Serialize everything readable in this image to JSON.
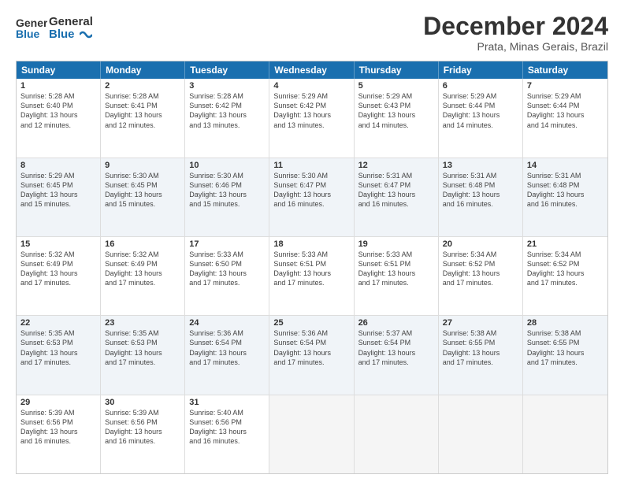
{
  "logo": {
    "general": "General",
    "blue": "Blue"
  },
  "header": {
    "title": "December 2024",
    "location": "Prata, Minas Gerais, Brazil"
  },
  "weekdays": [
    "Sunday",
    "Monday",
    "Tuesday",
    "Wednesday",
    "Thursday",
    "Friday",
    "Saturday"
  ],
  "rows": [
    [
      {
        "day": "1",
        "lines": [
          "Sunrise: 5:28 AM",
          "Sunset: 6:40 PM",
          "Daylight: 13 hours",
          "and 12 minutes."
        ]
      },
      {
        "day": "2",
        "lines": [
          "Sunrise: 5:28 AM",
          "Sunset: 6:41 PM",
          "Daylight: 13 hours",
          "and 12 minutes."
        ]
      },
      {
        "day": "3",
        "lines": [
          "Sunrise: 5:28 AM",
          "Sunset: 6:42 PM",
          "Daylight: 13 hours",
          "and 13 minutes."
        ]
      },
      {
        "day": "4",
        "lines": [
          "Sunrise: 5:29 AM",
          "Sunset: 6:42 PM",
          "Daylight: 13 hours",
          "and 13 minutes."
        ]
      },
      {
        "day": "5",
        "lines": [
          "Sunrise: 5:29 AM",
          "Sunset: 6:43 PM",
          "Daylight: 13 hours",
          "and 14 minutes."
        ]
      },
      {
        "day": "6",
        "lines": [
          "Sunrise: 5:29 AM",
          "Sunset: 6:44 PM",
          "Daylight: 13 hours",
          "and 14 minutes."
        ]
      },
      {
        "day": "7",
        "lines": [
          "Sunrise: 5:29 AM",
          "Sunset: 6:44 PM",
          "Daylight: 13 hours",
          "and 14 minutes."
        ]
      }
    ],
    [
      {
        "day": "8",
        "lines": [
          "Sunrise: 5:29 AM",
          "Sunset: 6:45 PM",
          "Daylight: 13 hours",
          "and 15 minutes."
        ]
      },
      {
        "day": "9",
        "lines": [
          "Sunrise: 5:30 AM",
          "Sunset: 6:45 PM",
          "Daylight: 13 hours",
          "and 15 minutes."
        ]
      },
      {
        "day": "10",
        "lines": [
          "Sunrise: 5:30 AM",
          "Sunset: 6:46 PM",
          "Daylight: 13 hours",
          "and 15 minutes."
        ]
      },
      {
        "day": "11",
        "lines": [
          "Sunrise: 5:30 AM",
          "Sunset: 6:47 PM",
          "Daylight: 13 hours",
          "and 16 minutes."
        ]
      },
      {
        "day": "12",
        "lines": [
          "Sunrise: 5:31 AM",
          "Sunset: 6:47 PM",
          "Daylight: 13 hours",
          "and 16 minutes."
        ]
      },
      {
        "day": "13",
        "lines": [
          "Sunrise: 5:31 AM",
          "Sunset: 6:48 PM",
          "Daylight: 13 hours",
          "and 16 minutes."
        ]
      },
      {
        "day": "14",
        "lines": [
          "Sunrise: 5:31 AM",
          "Sunset: 6:48 PM",
          "Daylight: 13 hours",
          "and 16 minutes."
        ]
      }
    ],
    [
      {
        "day": "15",
        "lines": [
          "Sunrise: 5:32 AM",
          "Sunset: 6:49 PM",
          "Daylight: 13 hours",
          "and 17 minutes."
        ]
      },
      {
        "day": "16",
        "lines": [
          "Sunrise: 5:32 AM",
          "Sunset: 6:49 PM",
          "Daylight: 13 hours",
          "and 17 minutes."
        ]
      },
      {
        "day": "17",
        "lines": [
          "Sunrise: 5:33 AM",
          "Sunset: 6:50 PM",
          "Daylight: 13 hours",
          "and 17 minutes."
        ]
      },
      {
        "day": "18",
        "lines": [
          "Sunrise: 5:33 AM",
          "Sunset: 6:51 PM",
          "Daylight: 13 hours",
          "and 17 minutes."
        ]
      },
      {
        "day": "19",
        "lines": [
          "Sunrise: 5:33 AM",
          "Sunset: 6:51 PM",
          "Daylight: 13 hours",
          "and 17 minutes."
        ]
      },
      {
        "day": "20",
        "lines": [
          "Sunrise: 5:34 AM",
          "Sunset: 6:52 PM",
          "Daylight: 13 hours",
          "and 17 minutes."
        ]
      },
      {
        "day": "21",
        "lines": [
          "Sunrise: 5:34 AM",
          "Sunset: 6:52 PM",
          "Daylight: 13 hours",
          "and 17 minutes."
        ]
      }
    ],
    [
      {
        "day": "22",
        "lines": [
          "Sunrise: 5:35 AM",
          "Sunset: 6:53 PM",
          "Daylight: 13 hours",
          "and 17 minutes."
        ]
      },
      {
        "day": "23",
        "lines": [
          "Sunrise: 5:35 AM",
          "Sunset: 6:53 PM",
          "Daylight: 13 hours",
          "and 17 minutes."
        ]
      },
      {
        "day": "24",
        "lines": [
          "Sunrise: 5:36 AM",
          "Sunset: 6:54 PM",
          "Daylight: 13 hours",
          "and 17 minutes."
        ]
      },
      {
        "day": "25",
        "lines": [
          "Sunrise: 5:36 AM",
          "Sunset: 6:54 PM",
          "Daylight: 13 hours",
          "and 17 minutes."
        ]
      },
      {
        "day": "26",
        "lines": [
          "Sunrise: 5:37 AM",
          "Sunset: 6:54 PM",
          "Daylight: 13 hours",
          "and 17 minutes."
        ]
      },
      {
        "day": "27",
        "lines": [
          "Sunrise: 5:38 AM",
          "Sunset: 6:55 PM",
          "Daylight: 13 hours",
          "and 17 minutes."
        ]
      },
      {
        "day": "28",
        "lines": [
          "Sunrise: 5:38 AM",
          "Sunset: 6:55 PM",
          "Daylight: 13 hours",
          "and 17 minutes."
        ]
      }
    ],
    [
      {
        "day": "29",
        "lines": [
          "Sunrise: 5:39 AM",
          "Sunset: 6:56 PM",
          "Daylight: 13 hours",
          "and 16 minutes."
        ]
      },
      {
        "day": "30",
        "lines": [
          "Sunrise: 5:39 AM",
          "Sunset: 6:56 PM",
          "Daylight: 13 hours",
          "and 16 minutes."
        ]
      },
      {
        "day": "31",
        "lines": [
          "Sunrise: 5:40 AM",
          "Sunset: 6:56 PM",
          "Daylight: 13 hours",
          "and 16 minutes."
        ]
      },
      {
        "day": "",
        "lines": []
      },
      {
        "day": "",
        "lines": []
      },
      {
        "day": "",
        "lines": []
      },
      {
        "day": "",
        "lines": []
      }
    ]
  ]
}
